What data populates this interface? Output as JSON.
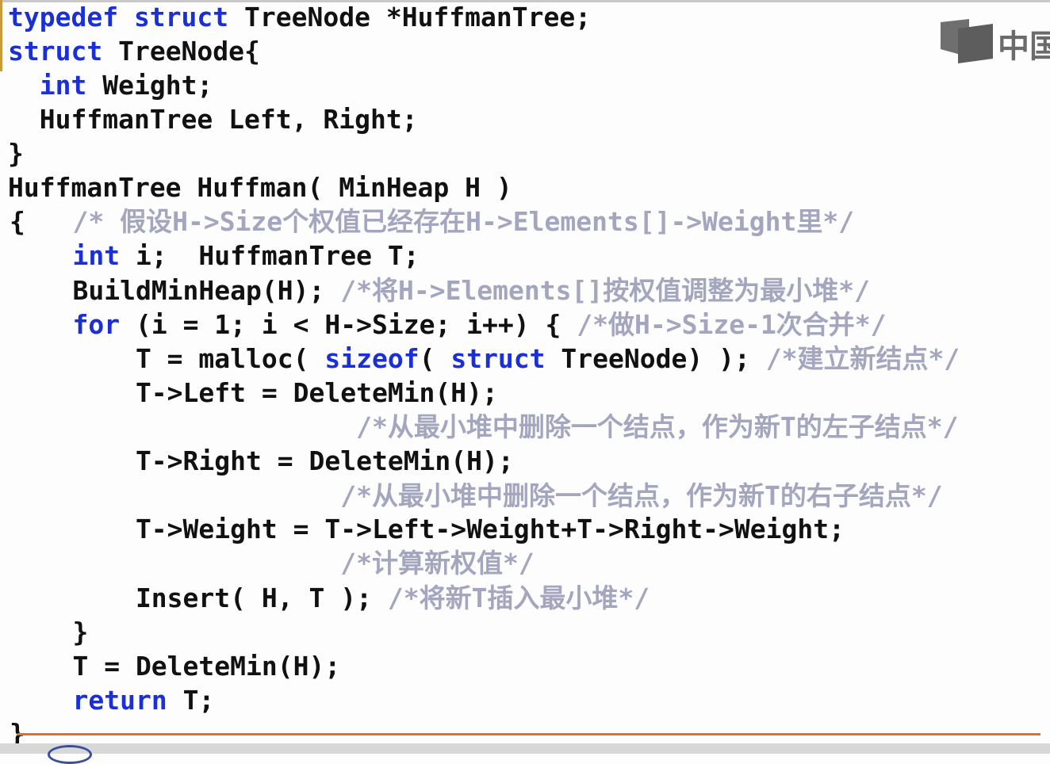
{
  "brand": {
    "logo_text": "中国"
  },
  "colors": {
    "keyword": "#1a2fd6",
    "comment": "#a3a6be",
    "text": "#111111",
    "accent_rule": "#d9722c"
  },
  "code": [
    {
      "segs": [
        {
          "t": "typedef struct",
          "c": "kw"
        },
        {
          "t": " TreeNode *HuffmanTree;",
          "c": "rs"
        }
      ]
    },
    {
      "segs": [
        {
          "t": "struct",
          "c": "kw"
        },
        {
          "t": " TreeNode{",
          "c": "rs"
        }
      ]
    },
    {
      "segs": [
        {
          "t": "  ",
          "c": "rs"
        },
        {
          "t": "int",
          "c": "kw"
        },
        {
          "t": " Weight;",
          "c": "rs"
        }
      ]
    },
    {
      "segs": [
        {
          "t": "  HuffmanTree Left, Right;",
          "c": "rs"
        }
      ]
    },
    {
      "segs": [
        {
          "t": "}",
          "c": "rs"
        }
      ]
    },
    {
      "segs": [
        {
          "t": "HuffmanTree Huffman( MinHeap H )",
          "c": "rs"
        }
      ]
    },
    {
      "segs": [
        {
          "t": "{   ",
          "c": "rs"
        },
        {
          "t": "/* 假设H->Size个权值已经存在H->Elements[]->Weight里*/",
          "c": "cm"
        }
      ]
    },
    {
      "segs": [
        {
          "t": "    ",
          "c": "rs"
        },
        {
          "t": "int",
          "c": "kw"
        },
        {
          "t": " i;  HuffmanTree T;",
          "c": "rs"
        }
      ]
    },
    {
      "segs": [
        {
          "t": "    BuildMinHeap(H); ",
          "c": "rs"
        },
        {
          "t": "/*将H->Elements[]按权值调整为最小堆*/",
          "c": "cm"
        }
      ]
    },
    {
      "segs": [
        {
          "t": "    ",
          "c": "rs"
        },
        {
          "t": "for",
          "c": "kw"
        },
        {
          "t": " (i = 1; i < H->Size; i++) { ",
          "c": "rs"
        },
        {
          "t": "/*做H->Size-1次合并*/",
          "c": "cm"
        }
      ]
    },
    {
      "segs": [
        {
          "t": "        T = malloc( ",
          "c": "rs"
        },
        {
          "t": "sizeof",
          "c": "kw"
        },
        {
          "t": "( ",
          "c": "rs"
        },
        {
          "t": "struct",
          "c": "kw"
        },
        {
          "t": " TreeNode) ); ",
          "c": "rs"
        },
        {
          "t": "/*建立新结点*/",
          "c": "cm"
        }
      ]
    },
    {
      "segs": [
        {
          "t": "        T->Left = DeleteMin(H);",
          "c": "rs"
        }
      ]
    },
    {
      "segs": [
        {
          "t": "                      ",
          "c": "rs"
        },
        {
          "t": "/*从最小堆中删除一个结点，作为新T的左子结点*/",
          "c": "cm"
        }
      ]
    },
    {
      "segs": [
        {
          "t": "        T->Right = DeleteMin(H);",
          "c": "rs"
        }
      ]
    },
    {
      "segs": [
        {
          "t": "                     ",
          "c": "rs"
        },
        {
          "t": "/*从最小堆中删除一个结点，作为新T的右子结点*/",
          "c": "cm"
        }
      ]
    },
    {
      "segs": [
        {
          "t": "        T->Weight = T->Left->Weight+T->Right->Weight;",
          "c": "rs"
        }
      ]
    },
    {
      "segs": [
        {
          "t": "                     ",
          "c": "rs"
        },
        {
          "t": "/*计算新权值*/",
          "c": "cm"
        }
      ]
    },
    {
      "segs": [
        {
          "t": "        Insert( H, T ); ",
          "c": "rs"
        },
        {
          "t": "/*将新T插入最小堆*/",
          "c": "cm"
        }
      ]
    },
    {
      "segs": [
        {
          "t": "    }",
          "c": "rs"
        }
      ]
    },
    {
      "segs": [
        {
          "t": "    T = DeleteMin(H);",
          "c": "rs"
        }
      ]
    },
    {
      "segs": [
        {
          "t": "    ",
          "c": "rs"
        },
        {
          "t": "return",
          "c": "kw"
        },
        {
          "t": " T;",
          "c": "rs"
        }
      ]
    },
    {
      "segs": [
        {
          "t": "}",
          "c": "rs"
        }
      ]
    }
  ]
}
